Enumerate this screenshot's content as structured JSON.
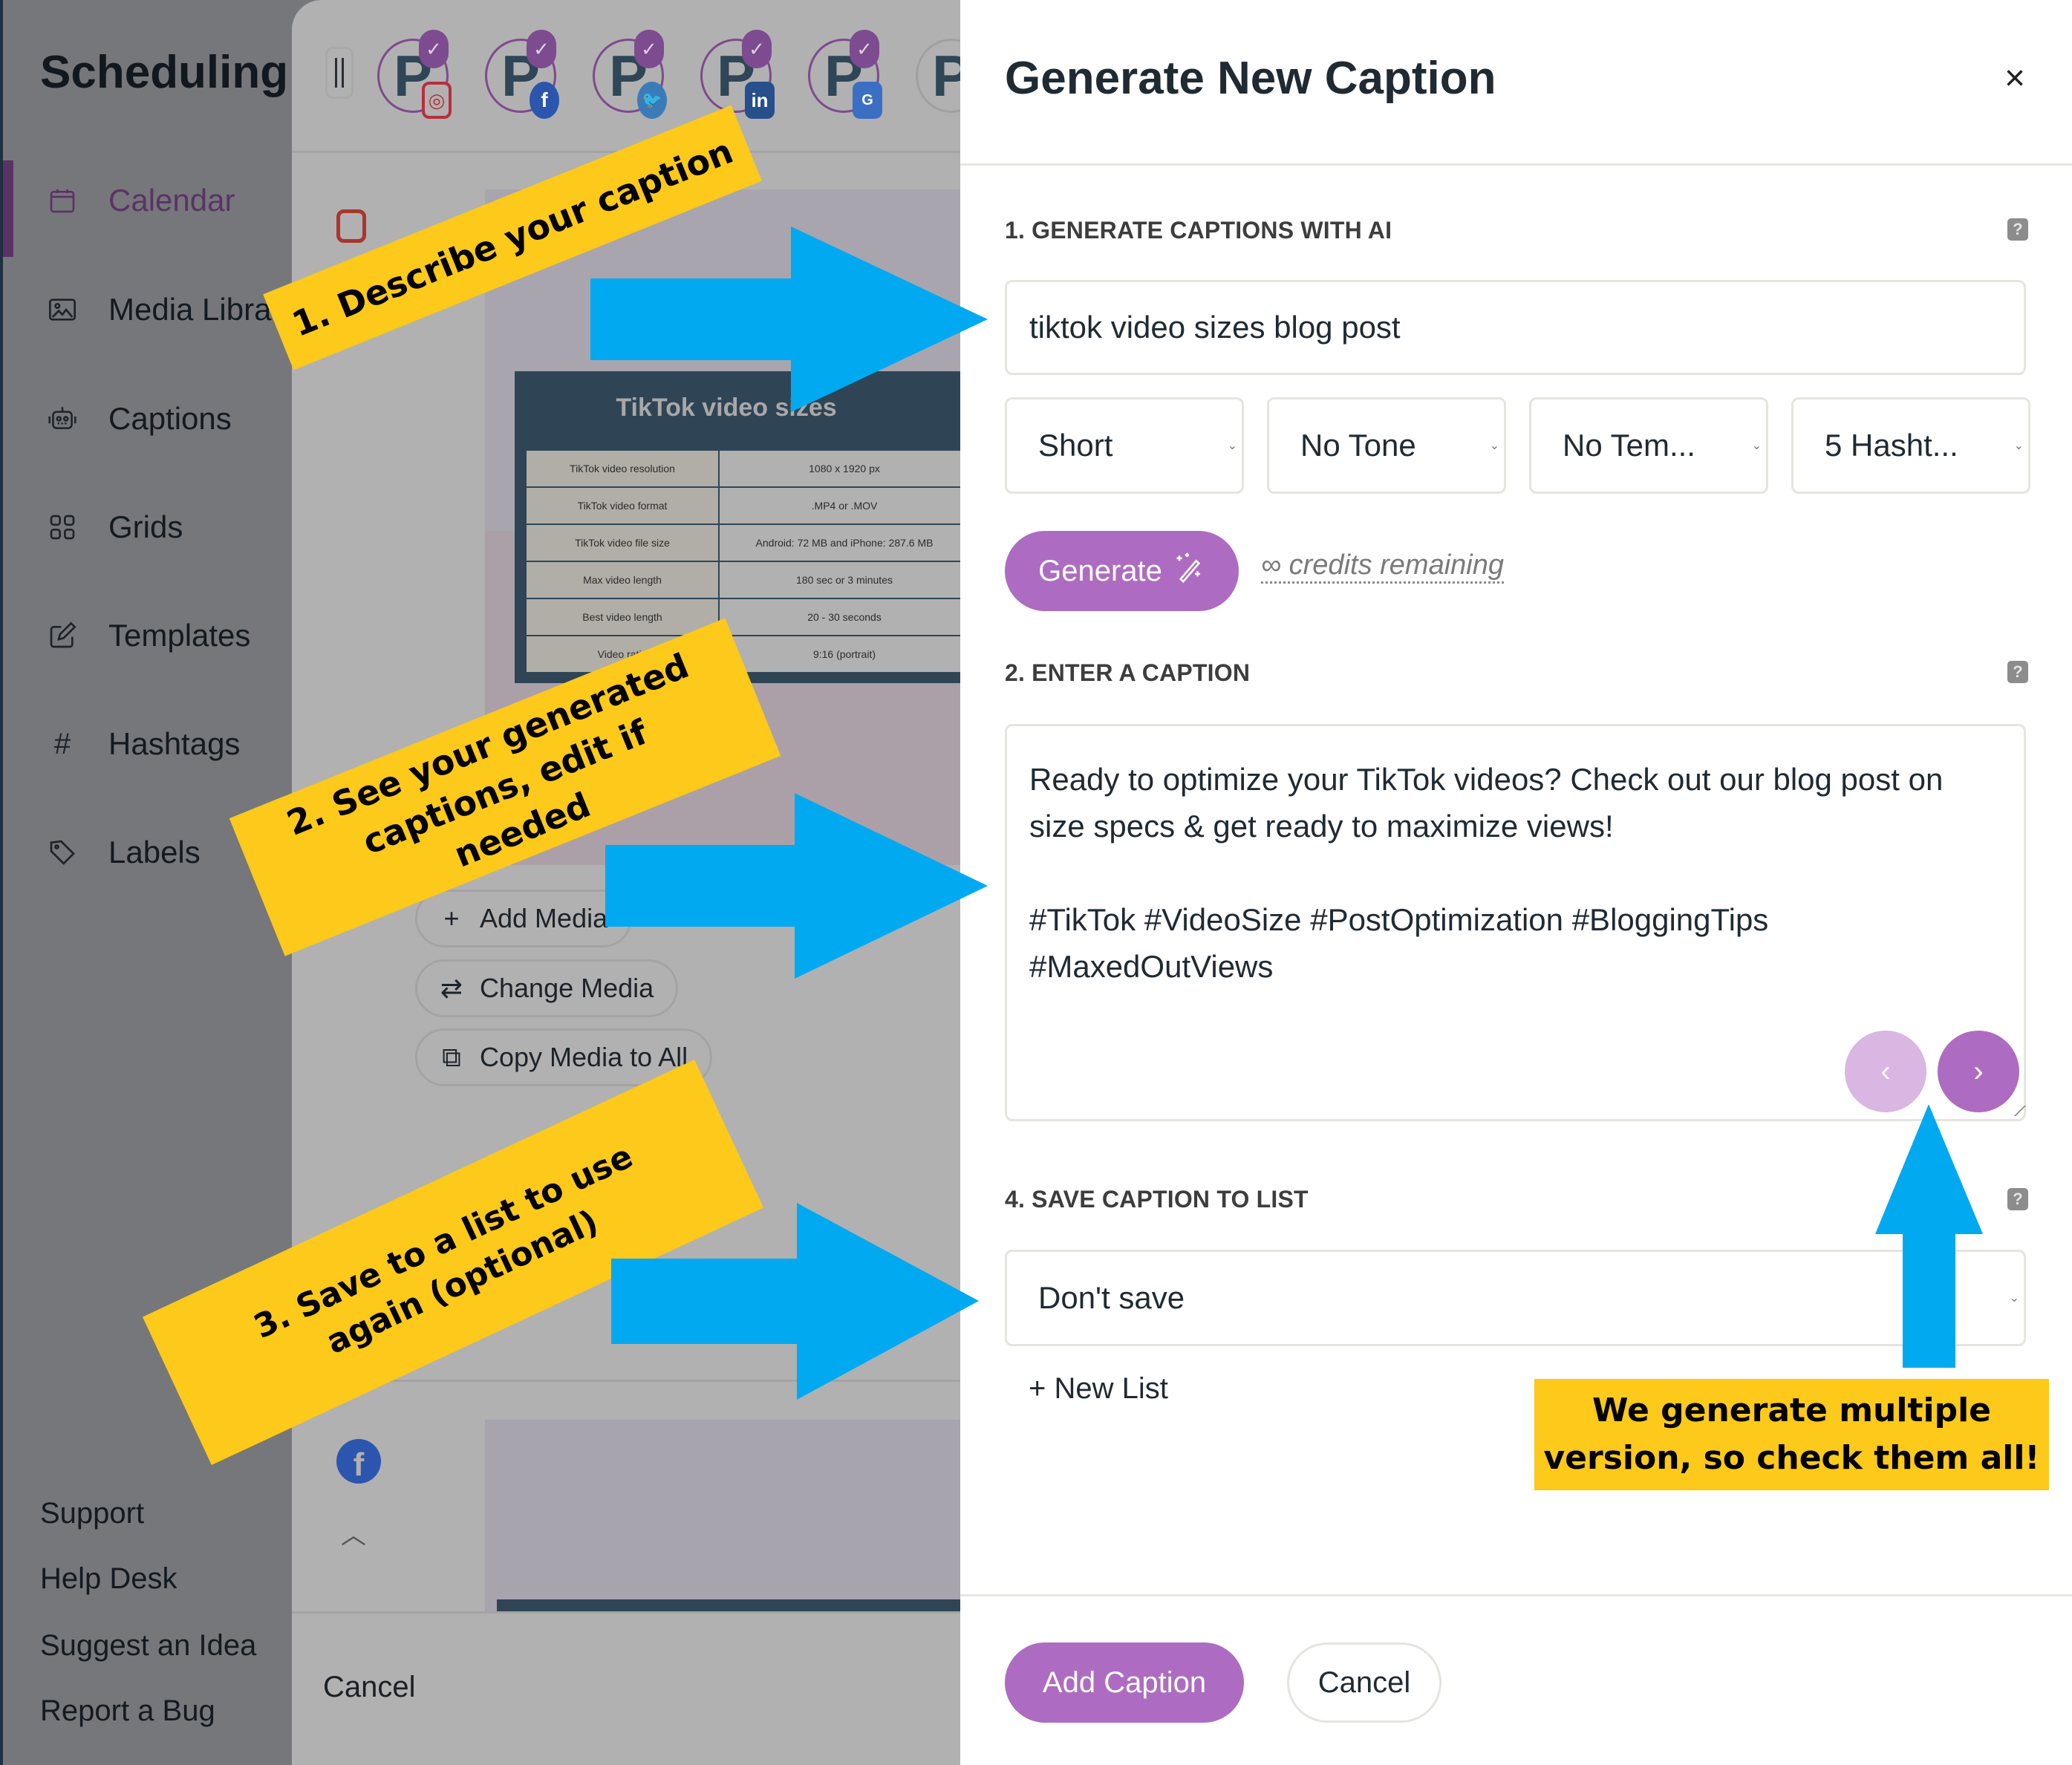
{
  "sidebar": {
    "brand": "Scheduling",
    "items": [
      {
        "label": "Calendar",
        "icon": "calendar-icon",
        "active": true
      },
      {
        "label": "Media Library",
        "icon": "image-icon"
      },
      {
        "label": "Captions",
        "icon": "robot-icon"
      },
      {
        "label": "Grids",
        "icon": "grid-icon"
      },
      {
        "label": "Templates",
        "icon": "edit-icon"
      },
      {
        "label": "Hashtags",
        "icon": "hashtag-icon"
      },
      {
        "label": "Labels",
        "icon": "tag-icon"
      }
    ],
    "footer_links": [
      "Support",
      "Help Desk",
      "Suggest an Idea",
      "Report a Bug"
    ]
  },
  "post_editor": {
    "accounts": [
      {
        "network": "instagram",
        "avatar_letter": "P",
        "selected": true
      },
      {
        "network": "facebook",
        "avatar_letter": "P",
        "selected": true
      },
      {
        "network": "twitter",
        "avatar_letter": "P",
        "selected": true
      },
      {
        "network": "linkedin",
        "avatar_letter": "P",
        "selected": true
      },
      {
        "network": "google-business",
        "avatar_letter": "P",
        "selected": true
      },
      {
        "network": "unknown",
        "avatar_letter": "P",
        "selected": false
      }
    ],
    "media_preview": {
      "title": "TikTok video sizes",
      "rows": [
        [
          "TikTok video resolution",
          "1080 x 1920 px"
        ],
        [
          "TikTok video format",
          ".MP4 or .MOV"
        ],
        [
          "TikTok video file size",
          "Android: 72 MB and iPhone: 287.6 MB"
        ],
        [
          "Max video length",
          "180 sec or 3 minutes"
        ],
        [
          "Best video length",
          "20 - 30 seconds"
        ],
        [
          "Video ratio",
          "9:16 (portrait)"
        ]
      ]
    },
    "media_buttons": {
      "add": "Add Media",
      "change": "Change Media",
      "copy": "Copy Media to All"
    },
    "cancel": "Cancel"
  },
  "modal": {
    "title": "Generate New Caption",
    "close_icon": "×",
    "section1": {
      "label": "1. GENERATE CAPTIONS WITH AI",
      "help": "?",
      "prompt_value": "tiktok video sizes blog post",
      "selects": [
        {
          "value": "Short"
        },
        {
          "value": "No Tone"
        },
        {
          "value": "No Tem..."
        },
        {
          "value": "5 Hasht..."
        }
      ],
      "generate_label": "Generate",
      "credits_text": "∞ credits remaining"
    },
    "section2": {
      "label": "2. ENTER A CAPTION",
      "help": "?",
      "caption": "Ready to optimize your TikTok videos? Check out our blog post on size specs & get ready to maximize views!\n\n#TikTok #VideoSize #PostOptimization #BloggingTips #MaxedOutViews",
      "prev_icon": "‹",
      "next_icon": "›"
    },
    "section4": {
      "label": "4. SAVE CAPTION TO LIST",
      "help": "?",
      "list_value": "Don't save",
      "new_list": "+ New List"
    },
    "footer": {
      "add_caption": "Add Caption",
      "cancel": "Cancel"
    }
  },
  "annotations": {
    "step1": "1. Describe your caption",
    "step2": "2. See your generated captions, edit if needed",
    "step3": "3. Save to a list to use again (optional)",
    "note": "We generate multiple version, so check them all!"
  },
  "colors": {
    "accent_purple": "#ad6cc1",
    "accent_purple_light": "#dab6e2",
    "sidebar_active": "#5a3366",
    "callout_yellow": "#fdc91a",
    "arrow_blue": "#00a9f0"
  }
}
